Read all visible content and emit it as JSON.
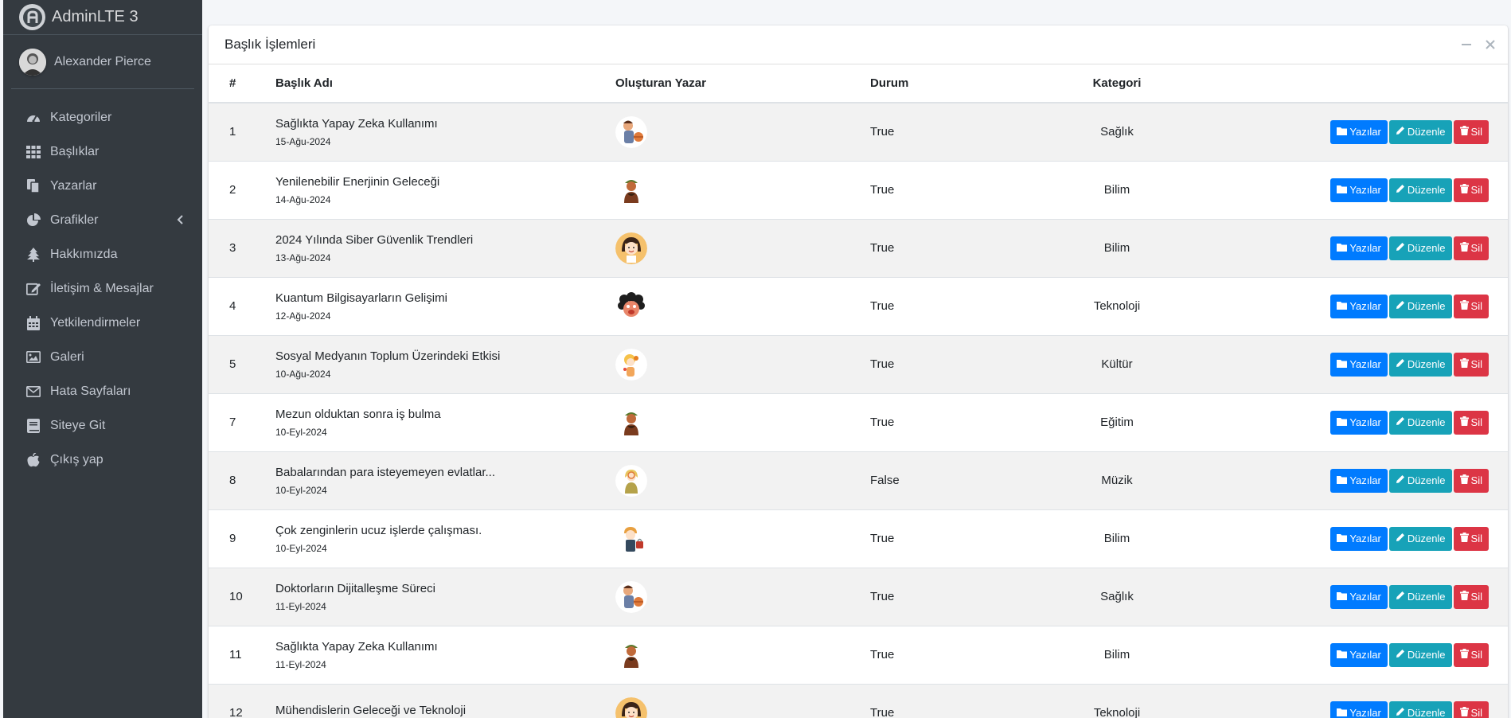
{
  "brand": {
    "name": "AdminLTE 3"
  },
  "user": {
    "name": "Alexander Pierce"
  },
  "nav": [
    {
      "label": "Kategoriler",
      "icon": "dashboard-gauge-icon"
    },
    {
      "label": "Başlıklar",
      "icon": "grid-icon"
    },
    {
      "label": "Yazarlar",
      "icon": "copy-icon"
    },
    {
      "label": "Grafikler",
      "icon": "pie-chart-icon"
    },
    {
      "label": "Hakkımızda",
      "icon": "tree-icon"
    },
    {
      "label": "İletişim & Mesajlar",
      "icon": "edit-icon"
    },
    {
      "label": "Yetkilendirmeler",
      "icon": "calendar-icon"
    },
    {
      "label": "Galeri",
      "icon": "image-icon"
    },
    {
      "label": "Hata Sayfaları",
      "icon": "envelope-icon"
    },
    {
      "label": "Siteye Git",
      "icon": "book-icon"
    },
    {
      "label": "Çıkış yap",
      "icon": "apple-icon"
    }
  ],
  "card": {
    "title": "Başlık İşlemleri"
  },
  "table": {
    "headers": {
      "num": "#",
      "title": "Başlık Adı",
      "author": "Oluşturan Yazar",
      "status": "Durum",
      "category": "Kategori"
    },
    "actions": {
      "posts": "Yazılar",
      "edit": "Düzenle",
      "delete": "Sil"
    },
    "rows": [
      {
        "id": "1",
        "title": "Sağlıkta Yapay Zeka Kullanımı",
        "date": "15-Ağu-2024",
        "status": "True",
        "category": "Sağlık",
        "avatar": "a"
      },
      {
        "id": "2",
        "title": "Yenilenebilir Enerjinin Geleceği",
        "date": "14-Ağu-2024",
        "status": "True",
        "category": "Bilim",
        "avatar": "b"
      },
      {
        "id": "3",
        "title": "2024 Yılında Siber Güvenlik Trendleri",
        "date": "13-Ağu-2024",
        "status": "True",
        "category": "Bilim",
        "avatar": "c"
      },
      {
        "id": "4",
        "title": "Kuantum Bilgisayarların Gelişimi",
        "date": "12-Ağu-2024",
        "status": "True",
        "category": "Teknoloji",
        "avatar": "d"
      },
      {
        "id": "5",
        "title": "Sosyal Medyanın Toplum Üzerindeki Etkisi",
        "date": "10-Ağu-2024",
        "status": "True",
        "category": "Kültür",
        "avatar": "e"
      },
      {
        "id": "7",
        "title": "Mezun olduktan sonra iş bulma",
        "date": "10-Eyl-2024",
        "status": "True",
        "category": "Eğitim",
        "avatar": "b"
      },
      {
        "id": "8",
        "title": "Babalarından para isteyemeyen evlatlar...",
        "date": "10-Eyl-2024",
        "status": "False",
        "category": "Müzik",
        "avatar": "f"
      },
      {
        "id": "9",
        "title": "Çok zenginlerin ucuz işlerde çalışması.",
        "date": "10-Eyl-2024",
        "status": "True",
        "category": "Bilim",
        "avatar": "g"
      },
      {
        "id": "10",
        "title": "Doktorların Dijitalleşme Süreci",
        "date": "11-Eyl-2024",
        "status": "True",
        "category": "Sağlık",
        "avatar": "a"
      },
      {
        "id": "11",
        "title": "Sağlıkta Yapay Zeka Kullanımı",
        "date": "11-Eyl-2024",
        "status": "True",
        "category": "Bilim",
        "avatar": "b"
      },
      {
        "id": "12",
        "title": "Mühendislerin Geleceği ve Teknoloji",
        "date": "",
        "status": "True",
        "category": "Teknoloji",
        "avatar": "c"
      }
    ]
  },
  "colors": {
    "sidebar": "#343a40",
    "primary": "#007bff",
    "info": "#17a2b8",
    "danger": "#dc3545"
  }
}
